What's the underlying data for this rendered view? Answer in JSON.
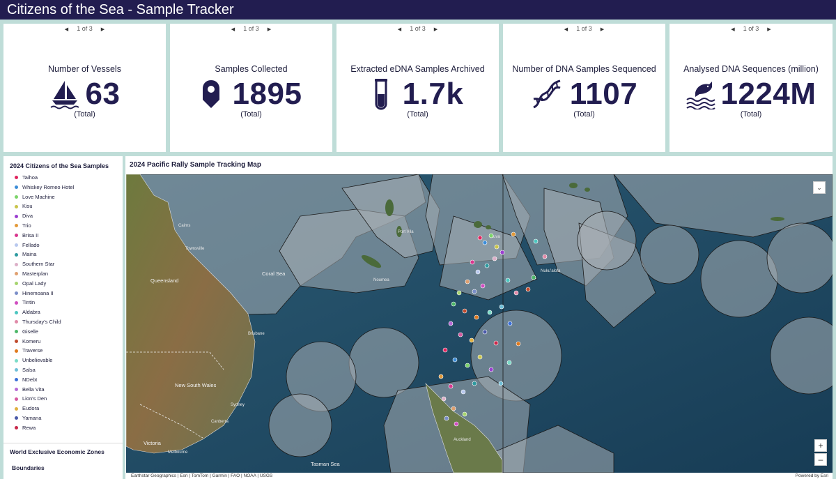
{
  "header": {
    "title": "Citizens of the Sea - Sample Tracker"
  },
  "cards": [
    {
      "pager": "1 of 3",
      "title": "Number of Vessels",
      "value": "63",
      "sub": "(Total)",
      "icon": "sailboat-icon"
    },
    {
      "pager": "1 of 3",
      "title": "Samples Collected",
      "value": "1895",
      "sub": "(Total)",
      "icon": "map-pin-icon"
    },
    {
      "pager": "1 of 3",
      "title": "Extracted eDNA Samples Archived",
      "value": "1.7k",
      "sub": "(Total)",
      "icon": "test-tube-icon"
    },
    {
      "pager": "1 of 3",
      "title": "Number of DNA Samples Sequenced",
      "value": "1107",
      "sub": "(Total)",
      "icon": "dna-icon"
    },
    {
      "pager": "1 of 3",
      "title": "Analysed DNA Sequences (million)",
      "value": "1224M",
      "sub": "(Total)",
      "icon": "fish-waves-icon"
    }
  ],
  "legend": {
    "title": "2024 Citizens of the Sea Samples",
    "items": [
      {
        "label": "Taihoa",
        "color": "#e0245e"
      },
      {
        "label": "Whiskey Romeo Hotel",
        "color": "#3c8dd8"
      },
      {
        "label": "Love Machine",
        "color": "#7cd46a"
      },
      {
        "label": "Kisu",
        "color": "#c9c44a"
      },
      {
        "label": "Diva",
        "color": "#9b3fd0"
      },
      {
        "label": "Trio",
        "color": "#e39a3a"
      },
      {
        "label": "Brisa II",
        "color": "#d8368e"
      },
      {
        "label": "Fellado",
        "color": "#b8c8ee"
      },
      {
        "label": "Maina",
        "color": "#2e9aa0"
      },
      {
        "label": "Southern Star",
        "color": "#dcb0c8"
      },
      {
        "label": "Masterplan",
        "color": "#e0a070"
      },
      {
        "label": "Opal Lady",
        "color": "#a6d46e"
      },
      {
        "label": "Hinemoana II",
        "color": "#7a8ec8"
      },
      {
        "label": "Tintin",
        "color": "#d04ec0"
      },
      {
        "label": "Aldabra",
        "color": "#4cc6c0"
      },
      {
        "label": "Thursday's Child",
        "color": "#e08aa8"
      },
      {
        "label": "Giselle",
        "color": "#4fb86a"
      },
      {
        "label": "Komeru",
        "color": "#c04b2e"
      },
      {
        "label": "Traverse",
        "color": "#e07a1e"
      },
      {
        "label": "Unbelievable",
        "color": "#7adcc8"
      },
      {
        "label": "Salsa",
        "color": "#6fbfd8"
      },
      {
        "label": "NDebt",
        "color": "#3a6fd8"
      },
      {
        "label": "Bella Vita",
        "color": "#b86ad6"
      },
      {
        "label": "Lion's Den",
        "color": "#d65aa0"
      },
      {
        "label": "Eudora",
        "color": "#e0b040"
      },
      {
        "label": "Yamana",
        "color": "#4a5aa8"
      },
      {
        "label": "Rewa",
        "color": "#c8284a"
      }
    ],
    "eez_title": "World Exclusive Economic Zones",
    "eez_sub": "Boundaries"
  },
  "map": {
    "title": "2024 Pacific Rally Sample Tracking Map",
    "attribution_left": "Earthstar Geographics | Esri | TomTom | Garmin | FAO | NOAA | USGS",
    "attribution_right": "Powered by Esri",
    "collapse_symbol": "⌄",
    "zoom_in_symbol": "+",
    "zoom_out_symbol": "–",
    "places": {
      "cairns": "Cairns",
      "townsville": "Townsville",
      "queensland": "Queensland",
      "coral_sea": "Coral Sea",
      "port_vila": "Port Vila",
      "noumea": "Noumea",
      "suva": "Suva",
      "nukualofa": "Nukuʻalofa",
      "brisbane": "Brisbane",
      "nsw": "New South Wales",
      "sydney": "Sydney",
      "canberra": "Canberra",
      "victoria": "Victoria",
      "melbourne": "Melbourne",
      "auckland": "Auckland",
      "tasman_sea": "Tasman Sea",
      "tasman_sea2": "Sea"
    }
  }
}
